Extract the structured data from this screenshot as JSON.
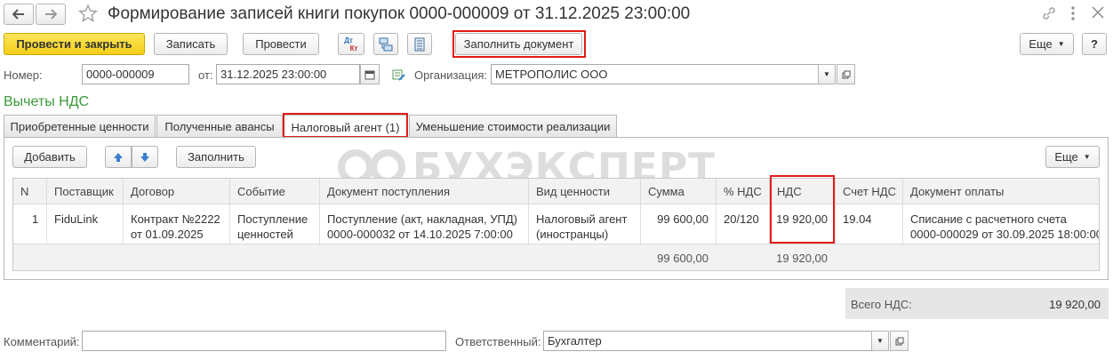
{
  "window": {
    "title": "Формирование записей книги покупок 0000-000009 от 31.12.2025 23:00:00"
  },
  "toolbar": {
    "post_close_label": "Провести и закрыть",
    "save_label": "Записать",
    "post_label": "Провести",
    "dtkt_label_dt": "Дт",
    "dtkt_label_kt": "Кт",
    "fill_doc_label": "Заполнить документ",
    "more_label": "Еще",
    "help_label": "?"
  },
  "form": {
    "number_label": "Номер:",
    "number_value": "0000-000009",
    "date_label": "от:",
    "date_value": "31.12.2025 23:00:00",
    "org_label": "Организация:",
    "org_value": "МЕТРОПОЛИС ООО",
    "section_title": "Вычеты НДС"
  },
  "tabs": [
    {
      "label": "Приобретенные ценности"
    },
    {
      "label": "Полученные авансы"
    },
    {
      "label": "Налоговый агент (1)"
    },
    {
      "label": "Уменьшение стоимости реализации"
    }
  ],
  "table_toolbar": {
    "add_label": "Добавить",
    "fill_label": "Заполнить",
    "more_label": "Еще"
  },
  "watermark": "БУХЭКСПЕРТ",
  "table": {
    "columns": [
      "N",
      "Поставщик",
      "Договор",
      "Событие",
      "Документ поступления",
      "Вид ценности",
      "Сумма",
      "% НДС",
      "НДС",
      "Счет НДС",
      "Документ оплаты"
    ],
    "rows": [
      {
        "n": "1",
        "supplier": "FiduLink",
        "contract_1": "Контракт №2222",
        "contract_2": "от 01.09.2025",
        "event_1": "Поступление",
        "event_2": "ценностей",
        "doc_1": "Поступление (акт, накладная, УПД)",
        "doc_2": "0000-000032 от 14.10.2025 7:00:00",
        "kind_1": "Налоговый агент",
        "kind_2": "(иностранцы)",
        "sum": "99 600,00",
        "rate": "20/120",
        "vat": "19 920,00",
        "account": "19.04",
        "pay_1": "Списание с расчетного счета",
        "pay_2": "0000-000029 от 30.09.2025 18:00:00"
      }
    ],
    "totals": {
      "sum": "99 600,00",
      "vat": "19 920,00"
    }
  },
  "summary": {
    "total_vat_label": "Всего НДС:",
    "total_vat_value": "19 920,00"
  },
  "footer": {
    "comment_label": "Комментарий:",
    "comment_value": "",
    "responsible_label": "Ответственный:",
    "responsible_value": "Бухгалтер"
  },
  "colors": {
    "accent_yellow": "#f3cf18",
    "highlight_red": "#e31b1b",
    "section_green": "#3b9a3b",
    "arrow_blue": "#3a7fd0"
  }
}
